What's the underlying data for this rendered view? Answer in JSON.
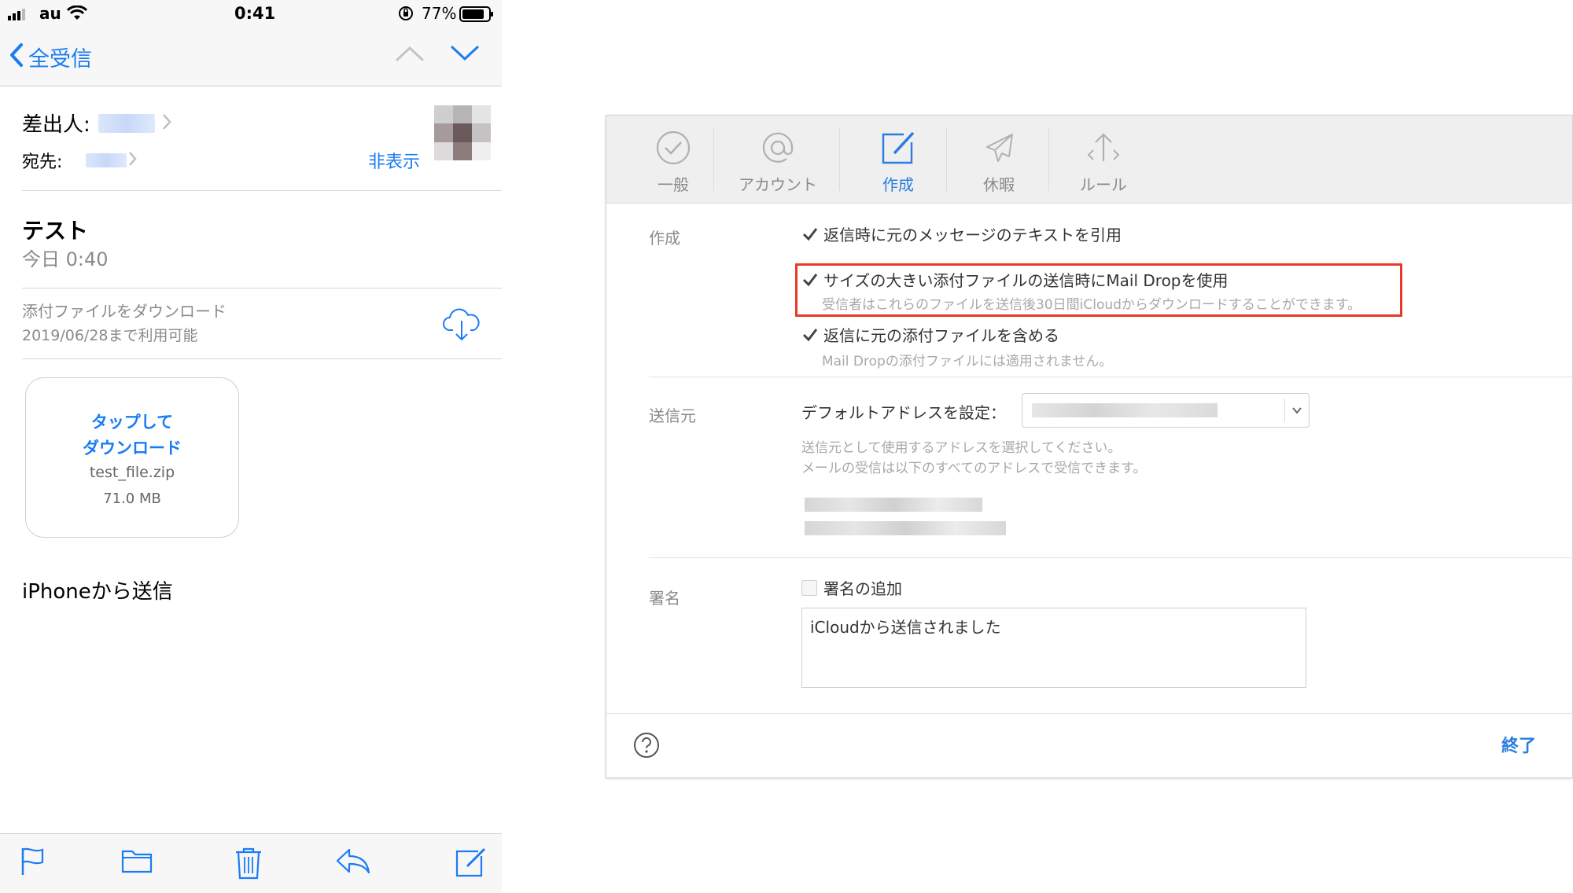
{
  "status_bar": {
    "carrier": "au",
    "time": "0:41",
    "battery": "77%"
  },
  "mail_nav": {
    "back_label": "全受信"
  },
  "message": {
    "from_label": "差出人:",
    "to_label": "宛先:",
    "hide_label": "非表示",
    "subject": "テスト",
    "date": "今日 0:40",
    "download_title": "添付ファイルをダウンロード",
    "download_until": "2019/06/28まで利用可能",
    "attachment": {
      "tap_line1": "タップして",
      "tap_line2": "ダウンロード",
      "file_name": "test_file.zip",
      "file_size": "71.0 MB"
    },
    "body": "iPhoneから送信"
  },
  "mail_toolbar": {
    "icons": [
      "flag-icon",
      "folder-icon",
      "trash-icon",
      "reply-icon",
      "compose-icon"
    ]
  },
  "settings": {
    "tabs": [
      {
        "label": "一般",
        "icon": "check-circle-icon",
        "active": false
      },
      {
        "label": "アカウント",
        "icon": "at-icon",
        "active": false
      },
      {
        "label": "作成",
        "icon": "compose-icon",
        "active": true
      },
      {
        "label": "休暇",
        "icon": "airplane-icon",
        "active": false
      },
      {
        "label": "ルール",
        "icon": "rules-arrows-icon",
        "active": false
      }
    ],
    "compose": {
      "section_label": "作成",
      "quote_original": "返信時に元のメッセージのテキストを引用",
      "mail_drop": "サイズの大きい添付ファイルの送信時にMail Dropを使用",
      "mail_drop_help": "受信者はこれらのファイルを送信後30日間iCloudからダウンロードすることができます。",
      "include_attachments": "返信に元の添付ファイルを含める",
      "include_attachments_help": "Mail Dropの添付ファイルには適用されません。"
    },
    "sender": {
      "section_label": "送信元",
      "default_address_label": "デフォルトアドレスを設定：",
      "help_line1": "送信元として使用するアドレスを選択してください。",
      "help_line2": "メールの受信は以下のすべてのアドレスで受信できます。"
    },
    "signature": {
      "section_label": "署名",
      "add_signature": "署名の追加",
      "signature_text": "iCloudから送信されました"
    },
    "done_label": "終了",
    "accent_color": "#2a7de0",
    "highlight_color": "#e8392a"
  }
}
